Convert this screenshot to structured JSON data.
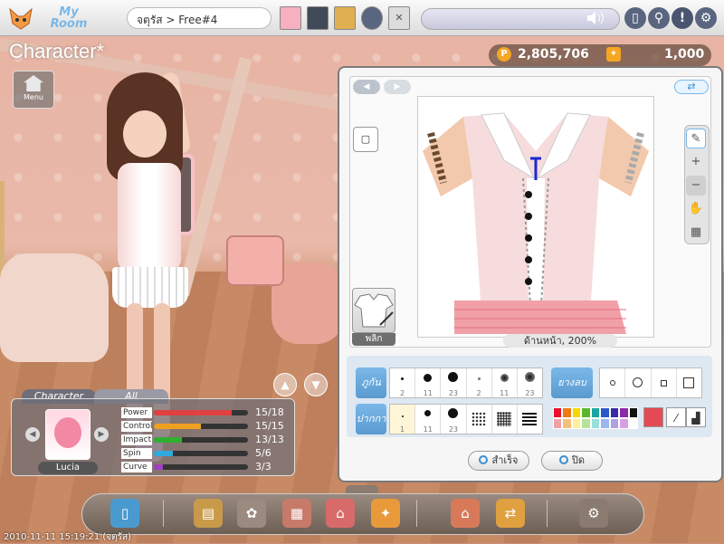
{
  "topbar": {
    "brand": "My Room",
    "location": "จตุรัส > Free#4",
    "slot_close_icon": "✕",
    "speaker_icon": "speaker-icon",
    "help_glyph": "!"
  },
  "heading": {
    "title": "Character*",
    "menu_label": "Menu"
  },
  "currency": {
    "points": "2,805,706",
    "tickets": "1,000"
  },
  "editor": {
    "swap_icon": "⇄",
    "layer_icon": "▢",
    "zoom_label": "ด้านหน้า, 200%",
    "preview_label": "พลิก",
    "brush": {
      "label": "ภูกัน",
      "sizes": [
        "2",
        "11",
        "23",
        "2",
        "11",
        "23"
      ]
    },
    "eraser": {
      "label": "ยางลบ"
    },
    "pattern": {
      "label": "ปากกา",
      "sizes": [
        "1",
        "11",
        "23",
        "",
        "",
        ""
      ]
    },
    "palette": [
      "#e8102a",
      "#f07a10",
      "#f5d800",
      "#5ab82c",
      "#1aa6a0",
      "#2a58c8",
      "#3a2aa8",
      "#8a2aa8",
      "#111111",
      "#f2a0a8",
      "#f5c07a",
      "#fff09a",
      "#b8e29a",
      "#9ae0da",
      "#9ab8ee",
      "#b0a0e0",
      "#d8a0e0",
      "#ffffff"
    ],
    "current_color": "#e34a53",
    "ok_label": "สำเร็จ",
    "close_label": "ปิด"
  },
  "stats": {
    "tab_character": "Character",
    "tab_all": "All",
    "name": "Lucia",
    "items": [
      {
        "label": "Power",
        "value": "15/18",
        "fill": 0.83,
        "color": "#e04040"
      },
      {
        "label": "Control",
        "value": "15/15",
        "fill": 0.5,
        "color": "#f0a020"
      },
      {
        "label": "Impact",
        "value": "13/13",
        "fill": 0.3,
        "color": "#30b030"
      },
      {
        "label": "Spin",
        "value": "5/6",
        "fill": 0.2,
        "color": "#30a8e0"
      },
      {
        "label": "Curve",
        "value": "3/3",
        "fill": 0.1,
        "color": "#a040c0"
      }
    ]
  },
  "dock_icons": [
    "door-icon",
    "shop-icon",
    "gift-icon",
    "box-icon",
    "house-icon",
    "puzzle-icon",
    "home-arrow-icon",
    "exchange-icon",
    "settings-icon"
  ],
  "timestamp": "2010-11-11 15:19:21 (จตุรัส)"
}
